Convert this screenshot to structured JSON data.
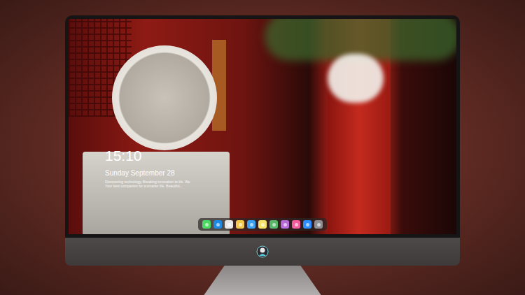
{
  "lock_screen": {
    "time": "15:10",
    "date": "Sunday September 28",
    "caption_lines": [
      "Discovering technology, Breaking innovation to life. We",
      "Your best companion for a smarter life. Beautiful..."
    ]
  },
  "dock": {
    "apps": [
      {
        "color": "#4cd964",
        "selected": false
      },
      {
        "color": "#1e88e5",
        "selected": false
      },
      {
        "color": "#e8e8e8",
        "selected": false
      },
      {
        "color": "#f2c94c",
        "selected": false
      },
      {
        "color": "#3aa0f0",
        "selected": false
      },
      {
        "color": "#f7e36b",
        "selected": false
      },
      {
        "color": "#59b56a",
        "selected": false
      },
      {
        "color": "#b56bd6",
        "selected": false
      },
      {
        "color": "#f25c9c",
        "selected": false
      },
      {
        "color": "#2f8cff",
        "selected": false
      },
      {
        "color": "#8e8e93",
        "selected": false
      }
    ]
  }
}
